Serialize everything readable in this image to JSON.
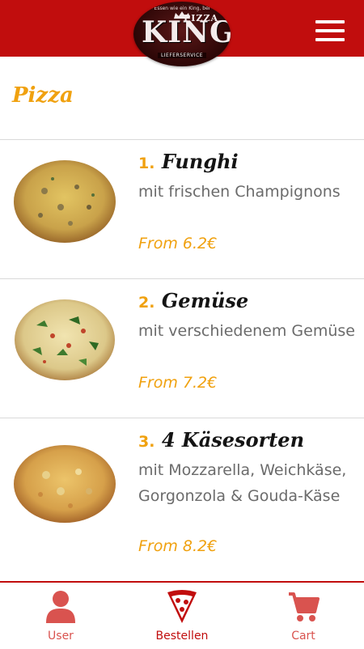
{
  "header": {
    "logo": {
      "tagline": "Essen wie ein King, bei",
      "pizza": "PIZZA",
      "name": "KING",
      "sub": "LIEFERSERVICE"
    },
    "menu_icon": "hamburger-menu-icon",
    "background_color": "#c10d0d"
  },
  "section": {
    "title": "Pizza"
  },
  "items": [
    {
      "number": "1.",
      "name": "Funghi",
      "description": "mit frischen Champignons",
      "price": "From 6.2€"
    },
    {
      "number": "2.",
      "name": "Gemüse",
      "description": "mit verschiedenem Gemüse",
      "price": "From 7.2€"
    },
    {
      "number": "3.",
      "name": "4 Käsesorten",
      "description": "mit Mozzarella, Weichkäse, Gorgonzola & Gouda-Käse",
      "price": "From 8.2€"
    }
  ],
  "bottom_nav": [
    {
      "label": "User",
      "icon": "user-icon",
      "active": false
    },
    {
      "label": "Bestellen",
      "icon": "pizza-slice-icon",
      "active": true
    },
    {
      "label": "Cart",
      "icon": "cart-icon",
      "active": false
    }
  ],
  "colors": {
    "brand_red": "#c10d0d",
    "accent_orange": "#f0a10f",
    "text_gray": "#6b6b6b"
  }
}
